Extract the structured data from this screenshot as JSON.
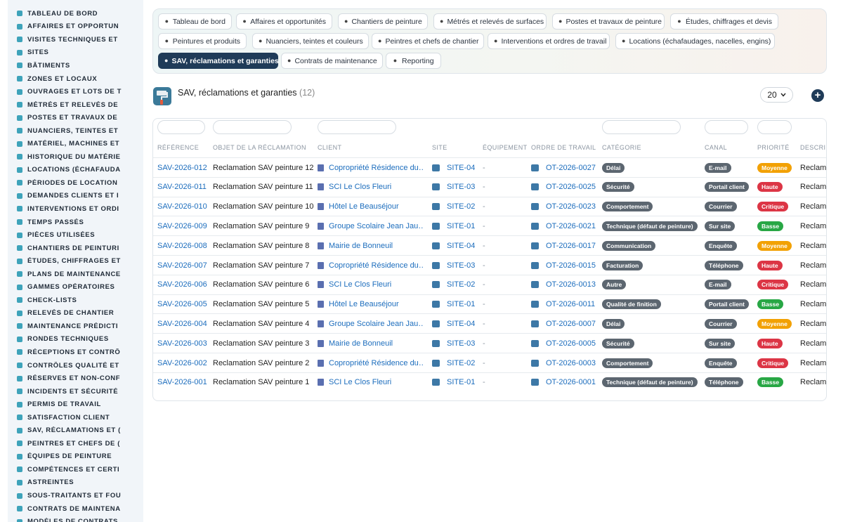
{
  "sidebar": {
    "items": [
      {
        "label": "TABLEAU DE BORD",
        "icon": "dashboard-icon"
      },
      {
        "label": "AFFAIRES ET OPPORTUN",
        "icon": "target-icon"
      },
      {
        "label": "VISITES TECHNIQUES ET",
        "icon": "eye-icon"
      },
      {
        "label": "SITES",
        "icon": "map-pin-icon"
      },
      {
        "label": "BÂTIMENTS",
        "icon": "building-icon"
      },
      {
        "label": "ZONES ET LOCAUX",
        "icon": "grid-icon"
      },
      {
        "label": "OUVRAGES ET LOTS DE T",
        "icon": "sitemap-icon"
      },
      {
        "label": "MÉTRÉS ET RELEVÉS DE",
        "icon": "ruler-icon"
      },
      {
        "label": "POSTES ET TRAVAUX DE",
        "icon": "paint-roller-icon"
      },
      {
        "label": "NUANCIERS, TEINTES ET",
        "icon": "palette-icon"
      },
      {
        "label": "MATÉRIEL, MACHINES ET",
        "icon": "cogs-icon"
      },
      {
        "label": "HISTORIQUE DU MATÉRIE",
        "icon": "history-icon"
      },
      {
        "label": "LOCATIONS (ÉCHAFAUDA",
        "icon": "truck-icon"
      },
      {
        "label": "PÉRIODES DE LOCATION",
        "icon": "calendar-icon"
      },
      {
        "label": "DEMANDES CLIENTS ET I",
        "icon": "inbox-icon"
      },
      {
        "label": "INTERVENTIONS ET ORDI",
        "icon": "clipboard-icon"
      },
      {
        "label": "TEMPS PASSÉS",
        "icon": "clock-icon"
      },
      {
        "label": "PIÈCES UTILISÉES",
        "icon": "box-icon"
      },
      {
        "label": "CHANTIERS DE PEINTURI",
        "icon": "hammer-icon"
      },
      {
        "label": "ÉTUDES, CHIFFRAGES ET",
        "icon": "calculator-icon"
      },
      {
        "label": "PLANS DE MAINTENANCE",
        "icon": "calendar-check-icon"
      },
      {
        "label": "GAMMES OPÉRATOIRES",
        "icon": "list-icon"
      },
      {
        "label": "CHECK-LISTS",
        "icon": "checklist-icon"
      },
      {
        "label": "RELEVÉS DE CHANTIER",
        "icon": "thermometer-icon"
      },
      {
        "label": "MAINTENANCE PRÉDICTI",
        "icon": "chart-line-icon"
      },
      {
        "label": "RONDES TECHNIQUES",
        "icon": "route-icon"
      },
      {
        "label": "RÉCEPTIONS ET CONTRÔ",
        "icon": "search-icon"
      },
      {
        "label": "CONTRÔLES QUALITÉ ET",
        "icon": "clipboard-check-icon"
      },
      {
        "label": "RÉSERVES ET NON-CONF",
        "icon": "alert-circle-icon"
      },
      {
        "label": "INCIDENTS ET SÉCURITÉ",
        "icon": "warning-icon"
      },
      {
        "label": "PERMIS DE TRAVAIL",
        "icon": "file-signature-icon"
      },
      {
        "label": "SATISFACTION CLIENT",
        "icon": "smile-icon"
      },
      {
        "label": "SAV, RÉCLAMATIONS ET (",
        "icon": "comment-icon"
      },
      {
        "label": "PEINTRES ET CHEFS DE (",
        "icon": "helmet-icon"
      },
      {
        "label": "ÉQUIPES DE PEINTURE",
        "icon": "users-icon"
      },
      {
        "label": "COMPÉTENCES ET CERTI",
        "icon": "certificate-icon"
      },
      {
        "label": "ASTREINTES",
        "icon": "phone-icon"
      },
      {
        "label": "SOUS-TRAITANTS ET FOU",
        "icon": "handshake-icon"
      },
      {
        "label": "CONTRATS DE MAINTENA",
        "icon": "file-contract-icon"
      },
      {
        "label": "MODÈLES DE CONTRATS",
        "icon": "file-icon"
      }
    ]
  },
  "tabs": [
    {
      "label": "Tableau de bord",
      "icon": "dashboard-icon",
      "active": false
    },
    {
      "label": "Affaires et opportunités",
      "icon": "target-icon",
      "active": false
    },
    {
      "label": "Chantiers de peinture",
      "icon": "hammer-icon",
      "active": false
    },
    {
      "label": "Métrés et relevés de surfaces",
      "icon": "ruler-icon",
      "active": false
    },
    {
      "label": "Postes et travaux de peinture",
      "icon": "paint-roller-icon",
      "active": false
    },
    {
      "label": "Études, chiffrages et devis",
      "icon": "calculator-icon",
      "active": false
    },
    {
      "label": "Peintures et produits",
      "icon": "fill-icon",
      "active": false
    },
    {
      "label": "Nuanciers, teintes et couleurs",
      "icon": "palette-icon",
      "active": false
    },
    {
      "label": "Peintres et chefs de chantier",
      "icon": "helmet-icon",
      "active": false
    },
    {
      "label": "Interventions et ordres de travail",
      "icon": "clipboard-icon",
      "active": false
    },
    {
      "label": "Locations (échafaudages, nacelles, engins)",
      "icon": "truck-icon",
      "active": false
    },
    {
      "label": "SAV, réclamations et garanties",
      "icon": "comment-icon",
      "active": true
    },
    {
      "label": "Contrats de maintenance",
      "icon": "file-contract-icon",
      "active": false
    },
    {
      "label": "Reporting",
      "icon": "pie-chart-icon",
      "active": false
    }
  ],
  "header": {
    "title": "SAV, réclamations et garanties",
    "count": "(12)",
    "page_size": "20"
  },
  "table": {
    "columns": [
      "RÉFÉRENCE",
      "OBJET DE LA RÉCLAMATION",
      "CLIENT",
      "SITE",
      "ÉQUIPEMENT",
      "ORDRE DE TRAVAIL",
      "CATÉGORIE",
      "CANAL",
      "PRIORITÉ",
      "DESCRIPTI"
    ],
    "rows": [
      {
        "ref": "SAV-2026-012",
        "objet": "Reclamation SAV peinture 12",
        "client": "Copropriété Résidence du…",
        "site": "SITE-04",
        "equip": "-",
        "ot": "OT-2026-0027",
        "cat": "Délai",
        "canal": "E-mail",
        "prio": "Moyenne",
        "desc": "Reclama"
      },
      {
        "ref": "SAV-2026-011",
        "objet": "Reclamation SAV peinture 11",
        "client": "SCI Le Clos Fleuri",
        "site": "SITE-03",
        "equip": "-",
        "ot": "OT-2026-0025",
        "cat": "Sécurité",
        "canal": "Portail client",
        "prio": "Haute",
        "desc": "Reclama"
      },
      {
        "ref": "SAV-2026-010",
        "objet": "Reclamation SAV peinture 10",
        "client": "Hôtel Le Beauséjour",
        "site": "SITE-02",
        "equip": "-",
        "ot": "OT-2026-0023",
        "cat": "Comportement",
        "canal": "Courrier",
        "prio": "Critique",
        "desc": "Reclama"
      },
      {
        "ref": "SAV-2026-009",
        "objet": "Reclamation SAV peinture 9",
        "client": "Groupe Scolaire Jean Jau…",
        "site": "SITE-01",
        "equip": "-",
        "ot": "OT-2026-0021",
        "cat": "Technique (défaut de peinture)",
        "canal": "Sur site",
        "prio": "Basse",
        "desc": "Reclama"
      },
      {
        "ref": "SAV-2026-008",
        "objet": "Reclamation SAV peinture 8",
        "client": "Mairie de Bonneuil",
        "site": "SITE-04",
        "equip": "-",
        "ot": "OT-2026-0017",
        "cat": "Communication",
        "canal": "Enquête",
        "prio": "Moyenne",
        "desc": "Reclama"
      },
      {
        "ref": "SAV-2026-007",
        "objet": "Reclamation SAV peinture 7",
        "client": "Copropriété Résidence du…",
        "site": "SITE-03",
        "equip": "-",
        "ot": "OT-2026-0015",
        "cat": "Facturation",
        "canal": "Téléphone",
        "prio": "Haute",
        "desc": "Reclama"
      },
      {
        "ref": "SAV-2026-006",
        "objet": "Reclamation SAV peinture 6",
        "client": "SCI Le Clos Fleuri",
        "site": "SITE-02",
        "equip": "-",
        "ot": "OT-2026-0013",
        "cat": "Autre",
        "canal": "E-mail",
        "prio": "Critique",
        "desc": "Reclama"
      },
      {
        "ref": "SAV-2026-005",
        "objet": "Reclamation SAV peinture 5",
        "client": "Hôtel Le Beauséjour",
        "site": "SITE-01",
        "equip": "-",
        "ot": "OT-2026-0011",
        "cat": "Qualité de finition",
        "canal": "Portail client",
        "prio": "Basse",
        "desc": "Reclama"
      },
      {
        "ref": "SAV-2026-004",
        "objet": "Reclamation SAV peinture 4",
        "client": "Groupe Scolaire Jean Jau…",
        "site": "SITE-04",
        "equip": "-",
        "ot": "OT-2026-0007",
        "cat": "Délai",
        "canal": "Courrier",
        "prio": "Moyenne",
        "desc": "Reclama"
      },
      {
        "ref": "SAV-2026-003",
        "objet": "Reclamation SAV peinture 3",
        "client": "Mairie de Bonneuil",
        "site": "SITE-03",
        "equip": "-",
        "ot": "OT-2026-0005",
        "cat": "Sécurité",
        "canal": "Sur site",
        "prio": "Haute",
        "desc": "Reclama"
      },
      {
        "ref": "SAV-2026-002",
        "objet": "Reclamation SAV peinture 2",
        "client": "Copropriété Résidence du…",
        "site": "SITE-02",
        "equip": "-",
        "ot": "OT-2026-0003",
        "cat": "Comportement",
        "canal": "Enquête",
        "prio": "Critique",
        "desc": "Reclama"
      },
      {
        "ref": "SAV-2026-001",
        "objet": "Reclamation SAV peinture 1",
        "client": "SCI Le Clos Fleuri",
        "site": "SITE-01",
        "equip": "-",
        "ot": "OT-2026-0001",
        "cat": "Technique (défaut de peinture)",
        "canal": "Téléphone",
        "prio": "Basse",
        "desc": "Reclama"
      }
    ]
  },
  "colors": {
    "accent": "#1f3b58",
    "link": "#1c6dbd",
    "sidebar_icon": "#3ea3ba",
    "priority_moyenne": "#f2a104",
    "priority_haute": "#dc3545",
    "priority_critique": "#dc3545",
    "priority_basse": "#28a745",
    "badge_gray": "#5c6670"
  }
}
